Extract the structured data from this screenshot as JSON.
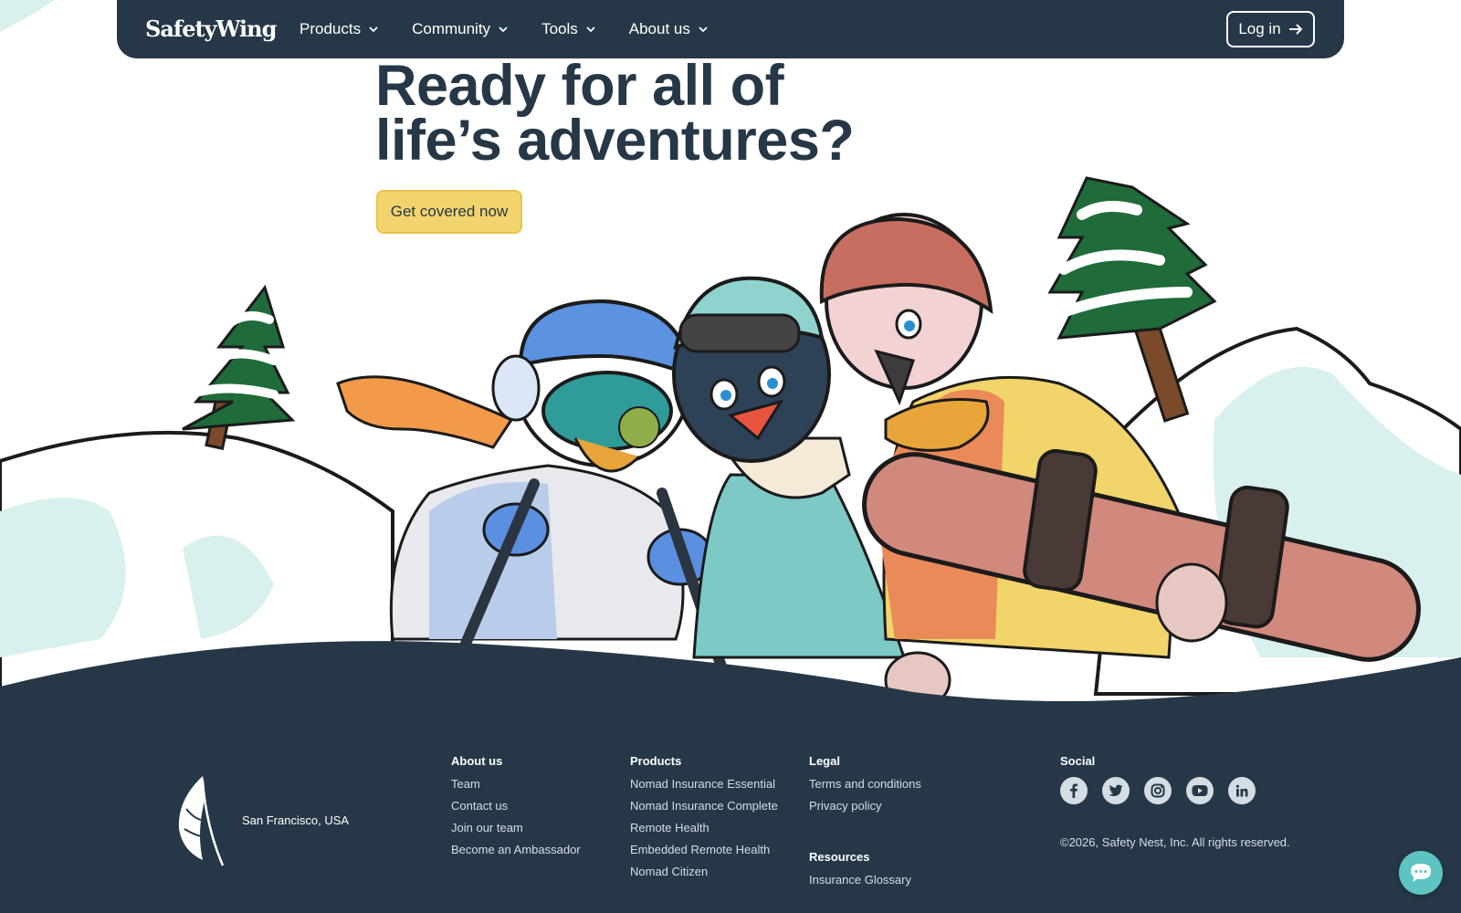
{
  "nav": {
    "logo": "SafetyWing",
    "menu": [
      {
        "label": "Products"
      },
      {
        "label": "Community"
      },
      {
        "label": "Tools"
      },
      {
        "label": "About us"
      }
    ],
    "login_label": "Log in"
  },
  "hero": {
    "title_line1": "Ready for all of",
    "title_line2": "life’s adventures?",
    "cta_label": "Get covered now"
  },
  "footer": {
    "location": "San Francisco, USA",
    "about": {
      "heading": "About us",
      "links": [
        "Team",
        "Contact us",
        "Join our team",
        "Become an Ambassador"
      ]
    },
    "products": {
      "heading": "Products",
      "links": [
        "Nomad Insurance Essential",
        "Nomad Insurance Complete",
        "Remote Health",
        "Embedded Remote Health",
        "Nomad Citizen"
      ]
    },
    "legal": {
      "heading": "Legal",
      "links": [
        "Terms and conditions",
        "Privacy policy"
      ]
    },
    "resources": {
      "heading": "Resources",
      "links": [
        "Insurance Glossary"
      ]
    },
    "social": {
      "heading": "Social",
      "icons": [
        "facebook-icon",
        "twitter-icon",
        "instagram-icon",
        "youtube-icon",
        "linkedin-icon"
      ]
    },
    "copyright": "©2026, Safety Nest, Inc. All rights reserved."
  },
  "colors": {
    "navy": "#263847",
    "cta_yellow": "#f2d46e",
    "chat_teal": "#5ec4c1",
    "snow_mint": "#d9f1ee"
  }
}
